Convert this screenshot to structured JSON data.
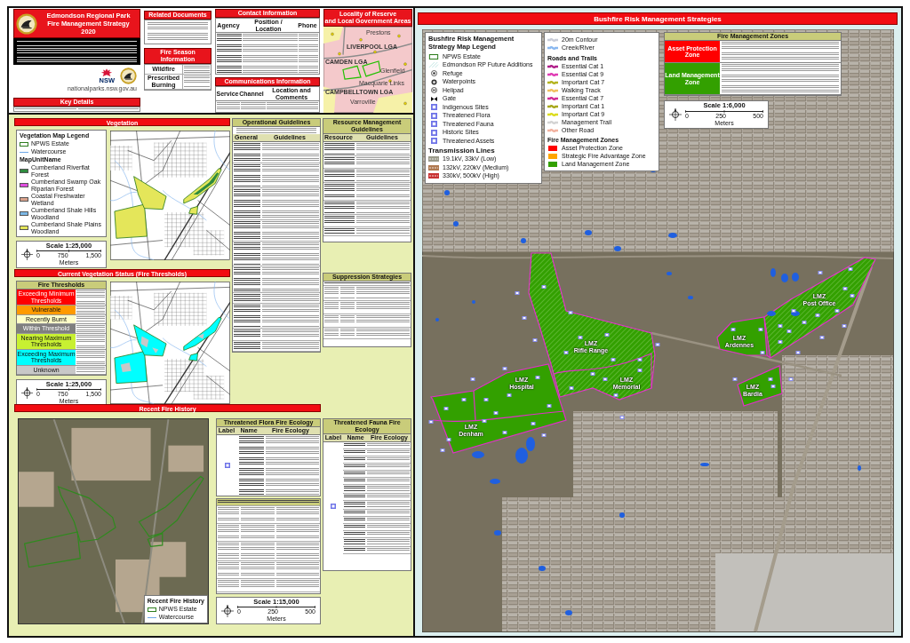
{
  "header": {
    "title_lines": [
      "Edmondson Regional Park",
      "Fire Management Strategy",
      "2020"
    ],
    "nsw_wordmark": "NSW",
    "website": "nationalparks.nsw.gov.au",
    "key_details_title": "Key Details"
  },
  "related_documents": {
    "title": "Related Documents"
  },
  "fire_season": {
    "title": "Fire Season Information",
    "rows": [
      "Wildfire",
      "Prescribed Burning"
    ]
  },
  "contact": {
    "title": "Contact Information",
    "columns": [
      "Agency",
      "Position / Location",
      "Phone"
    ]
  },
  "communications": {
    "title": "Communications Information",
    "columns": [
      "Service",
      "Channel",
      "Location and Comments"
    ]
  },
  "locality": {
    "title_lines": [
      "Locality of Reserve",
      "and Local Government Areas"
    ],
    "labels": [
      {
        "text": "Prestons",
        "kind": "suburb"
      },
      {
        "text": "LIVERPOOL LGA",
        "kind": "lga"
      },
      {
        "text": "CAMDEN LGA",
        "kind": "lga"
      },
      {
        "text": "Glenfield",
        "kind": "suburb"
      },
      {
        "text": "Macquarie Links",
        "kind": "suburb"
      },
      {
        "text": "CAMPBELLTOWN LGA",
        "kind": "lga"
      },
      {
        "text": "Varroville",
        "kind": "suburb"
      }
    ]
  },
  "vegetation": {
    "title": "Vegetation",
    "legend_title": "Vegetation Map Legend",
    "estate_label": "NPWS Estate",
    "watercourse_label": "Watercourse",
    "units_title": "MapUnitName",
    "units": [
      {
        "label": "Cumberland Riverflat Forest",
        "color": "#2e8b3e"
      },
      {
        "label": "Cumberland Swamp Oak Riparian Forest",
        "color": "#e04ee0"
      },
      {
        "label": "Coastal Freshwater Wetland",
        "color": "#d9a28c"
      },
      {
        "label": "Cumberland Shale Hills Woodland",
        "color": "#7cb8e6"
      },
      {
        "label": "Cumberland Shale Plains Woodland",
        "color": "#e4e65a"
      }
    ],
    "scale": {
      "title": "Scale 1:25,000",
      "ticks": [
        "0",
        "750",
        "1,500"
      ],
      "unit": "Meters"
    }
  },
  "fire_thresholds": {
    "title": "Current Vegetation Status (Fire Thresholds)",
    "table_title": "Fire Thresholds",
    "rows": [
      {
        "label": "Exceeding Minimum Thresholds",
        "color": "#ff0000"
      },
      {
        "label": "Vulnerable",
        "color": "#ff9a00"
      },
      {
        "label": "Recently Burnt",
        "color": "#ffffc8"
      },
      {
        "label": "Within Threshold",
        "color": "#7f7f7f"
      },
      {
        "label": "Nearing Maximum Thresholds",
        "color": "#c8f032"
      },
      {
        "label": "Exceeding Maximum Thresholds",
        "color": "#00ffff"
      },
      {
        "label": "Unknown",
        "color": "#c8c8c8"
      }
    ],
    "scale": {
      "title": "Scale 1:25,000",
      "ticks": [
        "0",
        "750",
        "1,500"
      ],
      "unit": "Meters"
    }
  },
  "operational_guidelines": {
    "title": "Operational Guidelines",
    "columns": [
      "General",
      "Guidelines"
    ]
  },
  "resource_guidelines": {
    "title": "Resource Management Guidelines",
    "columns": [
      "Resource",
      "Guidelines"
    ]
  },
  "suppression": {
    "title": "Suppression Strategies"
  },
  "fire_history": {
    "title": "Recent Fire History",
    "legend_title": "Recent Fire History",
    "estate_label": "NPWS Estate",
    "watercourse_label": "Watercourse",
    "scale": {
      "title": "Scale 1:15,000",
      "ticks": [
        "0",
        "250",
        "500"
      ],
      "unit": "Meters"
    }
  },
  "flora": {
    "title": "Threatened Flora Fire Ecology",
    "columns": [
      "Label",
      "Name",
      "Fire Ecology"
    ]
  },
  "fauna": {
    "title": "Threatened Fauna Fire Ecology",
    "columns": [
      "Label",
      "Name",
      "Fire Ecology"
    ]
  },
  "bushfire_map": {
    "title": "Bushfire Risk Management Strategies",
    "legend_title": "Bushfire Risk Management Strategy Map Legend",
    "symbols": [
      {
        "label": "NPWS Estate",
        "kind": "estate"
      },
      {
        "label": "Edmondson RP Future Additions",
        "kind": "hatch"
      },
      {
        "label": "Refuge",
        "kind": "refuge"
      },
      {
        "label": "Waterpoints",
        "kind": "waterpoint"
      },
      {
        "label": "Helipad",
        "kind": "helipad"
      },
      {
        "label": "Gate",
        "kind": "gate"
      },
      {
        "label": "Indigenous Sites",
        "kind": "site"
      },
      {
        "label": "Threatened Flora",
        "kind": "site"
      },
      {
        "label": "Threatened Fauna",
        "kind": "site"
      },
      {
        "label": "Historic Sites",
        "kind": "site"
      },
      {
        "label": "Threatened Assets",
        "kind": "site"
      }
    ],
    "transmission_title": "Transmission Lines",
    "transmission": [
      {
        "label": "19.1kV, 33kV (Low)",
        "color": "#9a9a8a"
      },
      {
        "label": "132kV, 220kV (Medium)",
        "color": "#b07a50"
      },
      {
        "label": "330kV, 500kV (High)",
        "color": "#c83232"
      }
    ],
    "lines": [
      {
        "label": "20m Contour",
        "color": "#c8ccd8"
      },
      {
        "label": "Creek/River",
        "color": "#8ab8f0"
      }
    ],
    "roads_title": "Roads and Trails",
    "roads": [
      {
        "label": "Essential Cat 1",
        "color": "#b0208a"
      },
      {
        "label": "Essential Cat 9",
        "color": "#e03cb4"
      },
      {
        "label": "Important Cat 7",
        "color": "#b4b420"
      },
      {
        "label": "Walking Track",
        "color": "#f0c060"
      },
      {
        "label": "Essential Cat 7",
        "color": "#d02c96"
      },
      {
        "label": "Important Cat 1",
        "color": "#a8a81c"
      },
      {
        "label": "Important Cat 9",
        "color": "#dcdc1e"
      },
      {
        "label": "Management Trail",
        "color": "#d4d4d4"
      },
      {
        "label": "Other Road",
        "color": "#f2b2a0"
      }
    ],
    "zones_title": "Fire Management Zones",
    "zones": [
      {
        "label": "Asset Protection Zone",
        "color": "#ff0000"
      },
      {
        "label": "Strategic Fire Advantage Zone",
        "color": "#ffa500"
      },
      {
        "label": "Land Management Zone",
        "color": "#33a000"
      }
    ],
    "zone_table": {
      "title": "Fire Management Zones",
      "rows": [
        {
          "name": "Asset Protection Zone",
          "color": "#ff0000"
        },
        {
          "name": "Land Management Zone",
          "color": "#33a000"
        }
      ]
    },
    "scale": {
      "title": "Scale 1:6,000",
      "ticks": [
        "0",
        "250",
        "500"
      ],
      "unit": "Meters"
    },
    "zone_labels": [
      {
        "zone": "LMZ",
        "name": "Post Office"
      },
      {
        "zone": "LMZ",
        "name": "Rifle Range"
      },
      {
        "zone": "LMZ",
        "name": "Ardennes"
      },
      {
        "zone": "LMZ",
        "name": "Hospital"
      },
      {
        "zone": "LMZ",
        "name": "Memorial"
      },
      {
        "zone": "LMZ",
        "name": "Bardia"
      },
      {
        "zone": "LMZ",
        "name": "Denham"
      }
    ]
  }
}
